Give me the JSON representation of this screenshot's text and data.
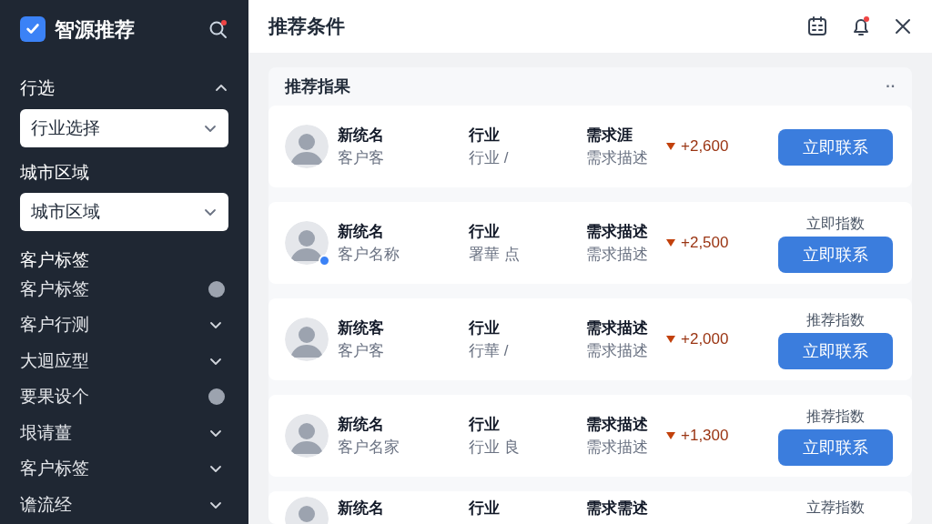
{
  "sidebar": {
    "app_title": "智源推荐",
    "filter_section": {
      "label": "行选",
      "expanded": true
    },
    "dropdowns": [
      {
        "value": "行业选择"
      },
      {
        "label": "城市区域",
        "value": "城市区域"
      }
    ],
    "tag_heading": "客户标签",
    "items": [
      {
        "label": "客户标签",
        "kind": "toggle"
      },
      {
        "label": "客户行测",
        "kind": "chevron"
      },
      {
        "label": "大迴应型",
        "kind": "chevron"
      },
      {
        "label": "要果设个",
        "kind": "toggle"
      },
      {
        "label": "垠请薑",
        "kind": "chevron"
      },
      {
        "label": "客户标签",
        "kind": "chevron"
      },
      {
        "label": "谵流经",
        "kind": "chevron"
      }
    ]
  },
  "header": {
    "title": "推荐条件"
  },
  "panel": {
    "title": "推荐指果",
    "more": "··",
    "cards": [
      {
        "name": "新统名",
        "subtitle": "客户客",
        "industry_label": "行业",
        "industry": "行业 /",
        "demand_label": "需求涯",
        "demand": "需求描述",
        "change": "+2,600",
        "button": "立即联系",
        "badge": false
      },
      {
        "name": "新统名",
        "subtitle": "客户名称",
        "industry_label": "行业",
        "industry": "署華 点",
        "demand_label": "需求描述",
        "demand": "需求描述",
        "change": "+2,500",
        "index_label": "立即指数",
        "button": "立即联系",
        "badge": true
      },
      {
        "name": "新统客",
        "subtitle": "客户客",
        "industry_label": "行业",
        "industry": "行華 /",
        "demand_label": "需求描述",
        "demand": "需求描述",
        "change": "+2,000",
        "index_label": "推荐指数",
        "button": "立即联系",
        "badge": false
      },
      {
        "name": "新统名",
        "subtitle": "客户名家",
        "industry_label": "行业",
        "industry": "行业 良",
        "demand_label": "需求描述",
        "demand": "需求描述",
        "change": "+1,300",
        "index_label": "推荐指数",
        "button": "立即联系",
        "badge": false
      },
      {
        "name": "新统名",
        "industry_label": "行业",
        "demand_label": "需求需述",
        "index_label": "立荐指数",
        "badge": false
      }
    ]
  }
}
